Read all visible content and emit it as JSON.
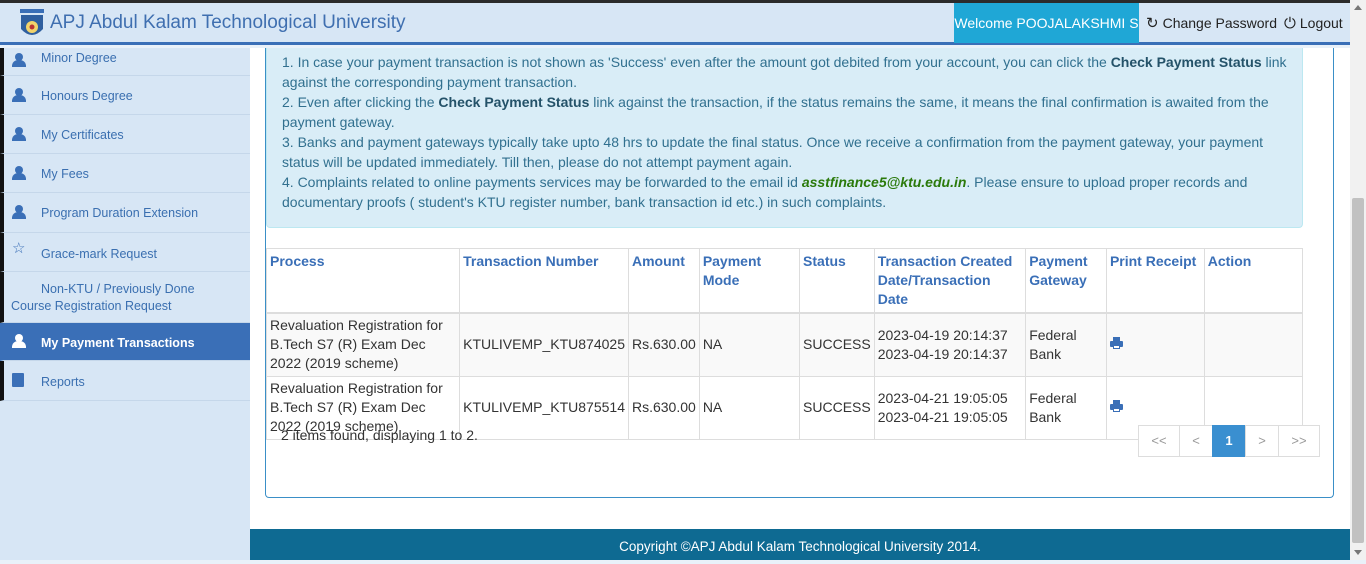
{
  "header": {
    "title": "APJ Abdul Kalam Technological University",
    "welcome": "Welcome POOJALAKSHMI S",
    "change_password": "Change Password",
    "logout": "Logout"
  },
  "sidebar": {
    "items": [
      {
        "label": "Minor Degree",
        "icon": "person-icon"
      },
      {
        "label": "Honours Degree",
        "icon": "person-icon"
      },
      {
        "label": "My Certificates",
        "icon": "person-icon"
      },
      {
        "label": "My Fees",
        "icon": "person-icon"
      },
      {
        "label": "Program Duration Extension",
        "icon": "person-icon"
      },
      {
        "label": "Grace-mark Request",
        "icon": "star-icon"
      },
      {
        "label": "Non-KTU / Previously Done Course Registration Request",
        "icon": "none"
      },
      {
        "label": "My Payment Transactions",
        "icon": "person-icon",
        "active": true
      },
      {
        "label": "Reports",
        "icon": "book-icon"
      }
    ]
  },
  "notice": {
    "l1a": "1. In case your payment transaction is not shown as 'Success' even after the amount got debited from your account, you can click the ",
    "l1b": "Check Payment Status",
    "l1c": " link against the corresponding payment transaction.",
    "l2a": "2. Even after clicking the ",
    "l2b": "Check Payment Status",
    "l2c": " link against the transaction, if the status remains the same, it means the final confirmation is awaited from the payment gateway.",
    "l3": "3. Banks and payment gateways typically take upto 48 hrs to update the final status. Once we receive a confirmation from the payment gateway, your payment status will be updated immediately. Till then, please do not attempt payment again.",
    "l4a": "4. Complaints related to online payments services may be forwarded to the email id ",
    "l4b": "asstfinance5@ktu.edu.in",
    "l4c": ". Please ensure to upload proper records and documentary proofs ( student's KTU register number, bank transaction id etc.) in such complaints."
  },
  "table": {
    "headers": [
      "Process",
      "Transaction Number",
      "Amount",
      "Payment Mode",
      "Status",
      "Transaction Created Date/Transaction Date",
      "Payment Gateway",
      "Print Receipt",
      "Action"
    ],
    "rows": [
      {
        "process": "Revaluation Registration for B.Tech S7 (R) Exam Dec 2022 (2019 scheme)",
        "txn": "KTULIVEMP_KTU874025",
        "amount": "Rs.630.00",
        "mode": "NA",
        "status": "SUCCESS",
        "created": "2023-04-19 20:14:37",
        "date": "2023-04-19 20:14:37",
        "gateway": "Federal Bank",
        "action": ""
      },
      {
        "process": "Revaluation Registration for B.Tech S7 (R) Exam Dec 2022 (2019 scheme)",
        "txn": "KTULIVEMP_KTU875514",
        "amount": "Rs.630.00",
        "mode": "NA",
        "status": "SUCCESS",
        "created": "2023-04-21 19:05:05",
        "date": "2023-04-21 19:05:05",
        "gateway": "Federal Bank",
        "action": ""
      }
    ]
  },
  "summary": "2 items found, displaying 1 to 2.",
  "pager": {
    "first": "<<",
    "prev": "<",
    "current": "1",
    "next": ">",
    "last": ">>"
  },
  "footer": "Copyright ©APJ Abdul Kalam Technological University 2014."
}
